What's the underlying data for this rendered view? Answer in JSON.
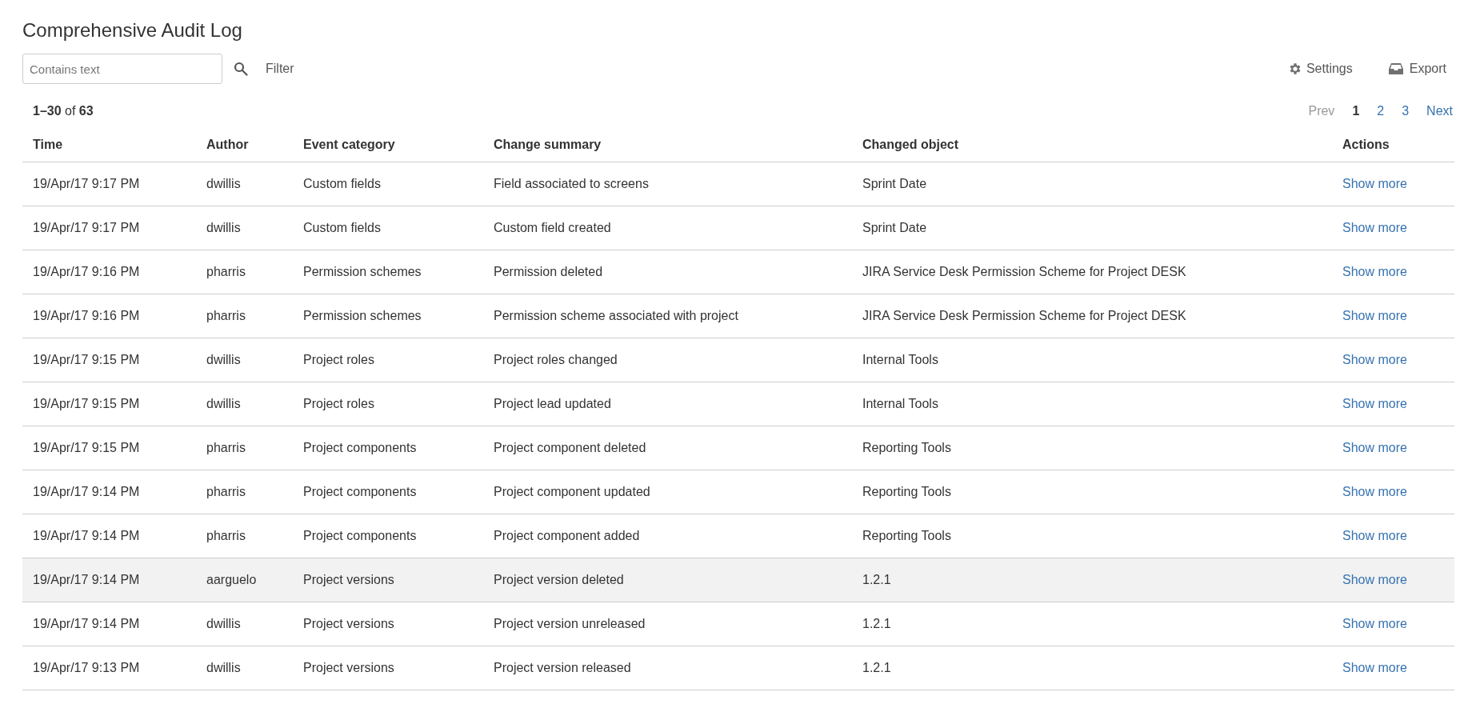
{
  "title": "Comprehensive Audit Log",
  "toolbar": {
    "search": {
      "placeholder": "Contains text"
    },
    "filter": "Filter",
    "settings": "Settings",
    "export": "Export"
  },
  "range": {
    "text": "**1–30** of **63**"
  },
  "pagination": {
    "prev": {
      "label": "Prev",
      "disabled": true
    },
    "pages": [
      {
        "label": "1",
        "selected": true
      },
      {
        "label": "2",
        "selected": false
      },
      {
        "label": "3",
        "selected": false
      }
    ],
    "next": {
      "label": "Next",
      "disabled": false
    }
  },
  "table": {
    "columns": [
      "Time",
      "Author",
      "Event category",
      "Change summary",
      "Changed object",
      "Actions"
    ],
    "rows": [
      {
        "cells": [
          "19/Apr/17 9:17 PM",
          "dwillis",
          "Custom fields",
          "Field associated to screens",
          "Sprint Date"
        ],
        "action": "Show more",
        "highlighted": false
      },
      {
        "cells": [
          "19/Apr/17 9:17 PM",
          "dwillis",
          "Custom fields",
          "Custom field created",
          "Sprint Date"
        ],
        "action": "Show more",
        "highlighted": false
      },
      {
        "cells": [
          "19/Apr/17 9:16 PM",
          "pharris",
          "Permission schemes",
          "Permission deleted",
          "JIRA Service Desk Permission Scheme for Project DESK"
        ],
        "action": "Show more",
        "highlighted": false
      },
      {
        "cells": [
          "19/Apr/17 9:16 PM",
          "pharris",
          "Permission schemes",
          "Permission scheme associated with project",
          "JIRA Service Desk Permission Scheme for Project DESK"
        ],
        "action": "Show more",
        "highlighted": false
      },
      {
        "cells": [
          "19/Apr/17 9:15 PM",
          "dwillis",
          "Project roles",
          "Project roles changed",
          "Internal Tools"
        ],
        "action": "Show more",
        "highlighted": false
      },
      {
        "cells": [
          "19/Apr/17 9:15 PM",
          "dwillis",
          "Project roles",
          "Project lead updated",
          "Internal Tools"
        ],
        "action": "Show more",
        "highlighted": false
      },
      {
        "cells": [
          "19/Apr/17 9:15 PM",
          "pharris",
          "Project components",
          "Project component deleted",
          "Reporting Tools"
        ],
        "action": "Show more",
        "highlighted": false
      },
      {
        "cells": [
          "19/Apr/17 9:14 PM",
          "pharris",
          "Project components",
          "Project component updated",
          "Reporting Tools"
        ],
        "action": "Show more",
        "highlighted": false
      },
      {
        "cells": [
          "19/Apr/17 9:14 PM",
          "pharris",
          "Project components",
          "Project component added",
          "Reporting Tools"
        ],
        "action": "Show more",
        "highlighted": false
      },
      {
        "cells": [
          "19/Apr/17 9:14 PM",
          "aarguelo",
          "Project versions",
          "Project version deleted",
          "1.2.1"
        ],
        "action": "Show more",
        "highlighted": true
      },
      {
        "cells": [
          "19/Apr/17 9:14 PM",
          "dwillis",
          "Project versions",
          "Project version unreleased",
          "1.2.1"
        ],
        "action": "Show more",
        "highlighted": false
      },
      {
        "cells": [
          "19/Apr/17 9:13 PM",
          "dwillis",
          "Project versions",
          "Project version released",
          "1.2.1"
        ],
        "action": "Show more",
        "highlighted": false
      }
    ]
  }
}
